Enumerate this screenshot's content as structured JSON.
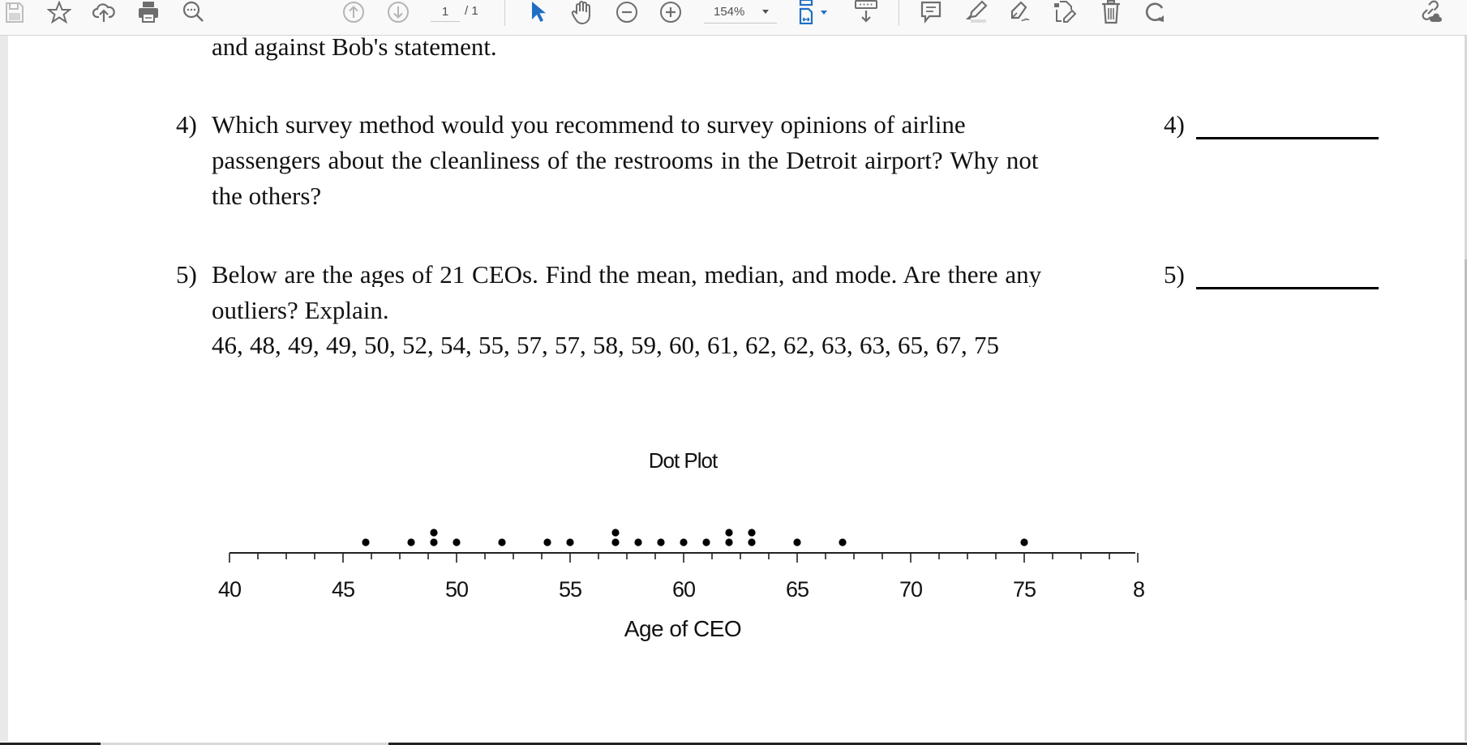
{
  "toolbar": {
    "left_icons": [
      {
        "name": "save-icon",
        "label": "Save"
      },
      {
        "name": "bookmark-star-icon",
        "label": "Bookmark"
      },
      {
        "name": "upload-cloud-icon",
        "label": "Upload"
      },
      {
        "name": "print-icon",
        "label": "Print"
      },
      {
        "name": "find-icon",
        "label": "Find"
      }
    ],
    "page_nav": {
      "current_page": "1",
      "total_label": "/ 1"
    },
    "zoom": {
      "value": "154%"
    },
    "tools": [
      "select-pointer",
      "hand",
      "zoom-out",
      "zoom-in",
      "fit-page",
      "scroll-mode",
      "comment",
      "highlight",
      "sign",
      "edit-pdf",
      "delete",
      "rotate",
      "share-link"
    ],
    "colors": {
      "active_blue": "#1f6fc5",
      "icon_gray": "#6e6e6e",
      "disabled_gray": "#b5b5b5"
    }
  },
  "document": {
    "prev_continuation": "and against Bob's statement.",
    "questions": [
      {
        "number": "4)",
        "lines": [
          "Which survey method would you recommend to survey opinions of airline",
          "passengers about the cleanliness of the restrooms in the Detroit airport? Why not",
          "the others?"
        ],
        "answer_label": "4)"
      },
      {
        "number": "5)",
        "lines": [
          "Below are the ages of 21 CEOs. Find the mean, median, and mode. Are there any",
          "outliers? Explain.",
          "46, 48, 49, 49, 50, 52, 54, 55, 57, 57, 58, 59, 60, 61, 62, 62, 63, 63, 65, 67, 75"
        ],
        "answer_label": "5)"
      }
    ]
  },
  "chart_data": {
    "type": "scatter",
    "subtype": "dot-plot",
    "title": "Dot Plot",
    "xlabel": "Age of CEO",
    "ylabel": "",
    "xlim": [
      40,
      80
    ],
    "x_ticks": [
      40,
      45,
      50,
      55,
      60,
      65,
      70,
      75,
      80
    ],
    "x_tick_labels": [
      "40",
      "45",
      "50",
      "55",
      "60",
      "65",
      "70",
      "75",
      "8"
    ],
    "minor_tick_step": 1.25,
    "values": [
      46,
      48,
      49,
      49,
      50,
      52,
      54,
      55,
      57,
      57,
      58,
      59,
      60,
      61,
      62,
      62,
      63,
      63,
      65,
      67,
      75
    ],
    "grid": false,
    "legend": "none"
  }
}
